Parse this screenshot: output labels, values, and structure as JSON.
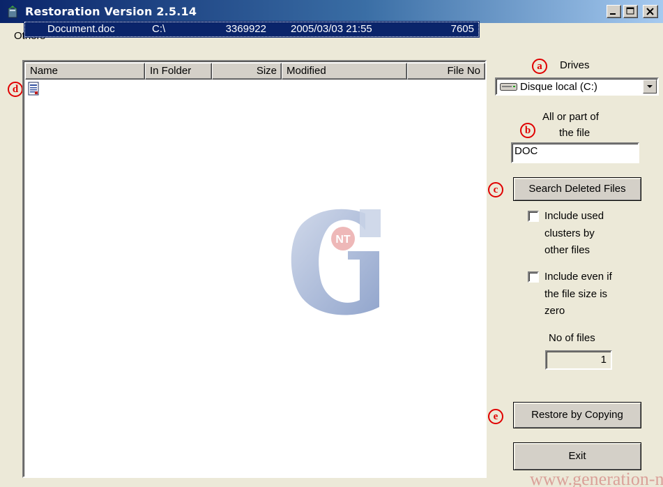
{
  "window": {
    "title": "Restoration Version 2.5.14"
  },
  "menu": {
    "others": "Others"
  },
  "list": {
    "columns": [
      "Name",
      "In Folder",
      "Size",
      "Modified",
      "File No"
    ],
    "rows": [
      {
        "name": "Document.doc",
        "folder": "C:\\",
        "size": "3369922",
        "modified": "2005/03/03 21:55",
        "file_no": "7605"
      }
    ]
  },
  "callouts": {
    "a": "a",
    "b": "b",
    "c": "c",
    "d": "d",
    "e": "e"
  },
  "drives": {
    "label": "Drives",
    "selected": "Disque local (C:)"
  },
  "search": {
    "label_line1": "All or part of",
    "label_line2": "the file",
    "value": "DOC",
    "button": "Search Deleted Files"
  },
  "options": {
    "include_used": {
      "line1": "Include used",
      "line2": "clusters by",
      "line3": "other files",
      "checked": false
    },
    "include_zero": {
      "line1": "Include even if",
      "line2": "the file size is",
      "line3": "zero",
      "checked": false
    }
  },
  "count": {
    "label": "No of files",
    "value": "1"
  },
  "actions": {
    "restore": "Restore by Copying",
    "exit": "Exit"
  },
  "watermark": {
    "logo_text": "NT",
    "url": "www.generation-nt.com"
  },
  "colors": {
    "selection": "#0a246a",
    "callout": "#e00000",
    "face": "#d4d0c8"
  }
}
